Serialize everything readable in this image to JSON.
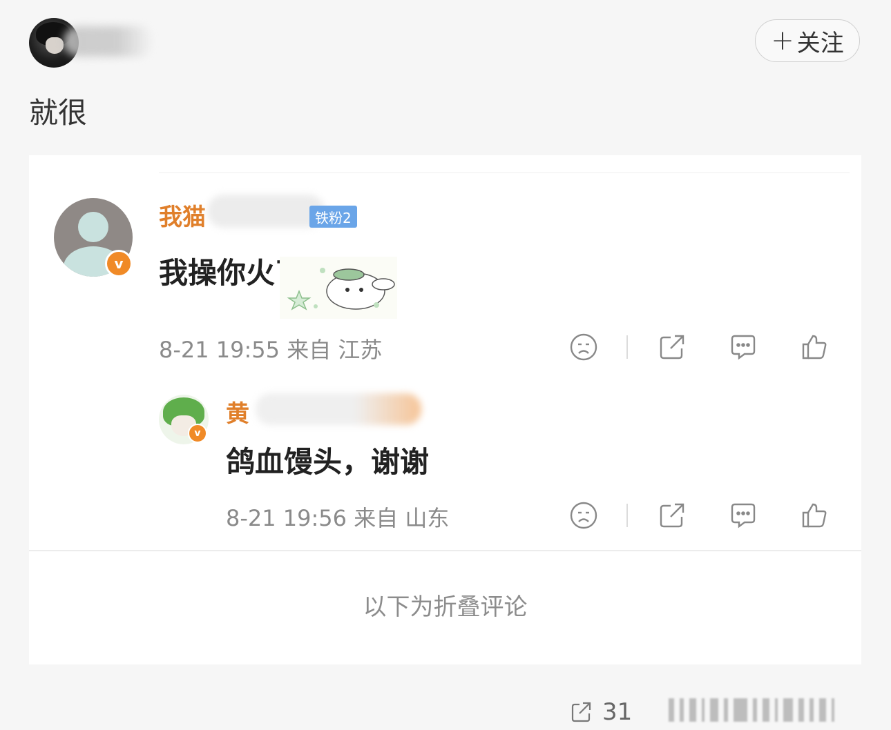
{
  "post": {
    "author_avatar_icon": "user-avatar",
    "follow_label": "关注",
    "follow_icon": "plus-icon",
    "text": "就很"
  },
  "comments": [
    {
      "name_visible": "我猫",
      "fan_badge": "铁粉2",
      "text": "我操你火了",
      "time": "8-21 19:55",
      "location": "来自 江苏",
      "verified_icon": "verified-badge-icon"
    },
    {
      "name_visible": "黄",
      "text": "鸽血馒头，谢谢",
      "time": "8-21 19:56",
      "location": "来自 山东",
      "verified_icon": "verified-badge-icon"
    }
  ],
  "folded_comments_label": "以下为折叠评论",
  "footer": {
    "repost_count": "31"
  },
  "colors": {
    "username": "#e07f2a",
    "badge_blue": "#6aa5e8",
    "verified_orange": "#f08a27",
    "meta_grey": "#8a8a8a"
  }
}
